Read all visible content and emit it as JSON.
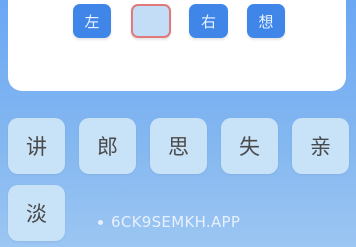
{
  "answer": {
    "slots": [
      {
        "char": "左",
        "filled": true
      },
      {
        "char": "",
        "filled": false
      },
      {
        "char": "右",
        "filled": true
      },
      {
        "char": "想",
        "filled": true
      }
    ]
  },
  "candidates": [
    "讲",
    "郎",
    "思",
    "失",
    "亲",
    "淡"
  ],
  "watermark": "6CK9SEMKH.APP",
  "colors": {
    "background": "#7fb2ee",
    "panel": "#ffffff",
    "slot_filled": "#3f86e8",
    "slot_empty": "#c3ddf7",
    "slot_empty_border": "#e07a7a",
    "tile": "#c8e2f8"
  }
}
